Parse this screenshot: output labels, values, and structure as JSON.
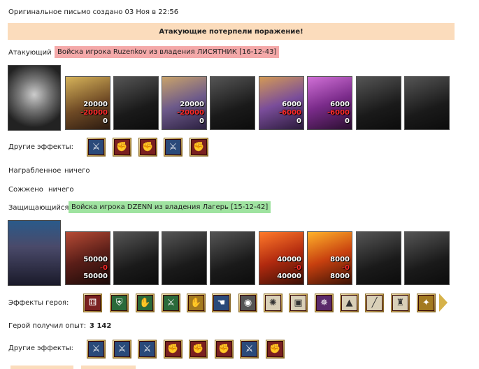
{
  "header": {
    "created": "Оригинальное письмо создано 03 Ноя в 22:56",
    "banner": "Атакующие потерпели поражение!"
  },
  "attacker": {
    "label": "Атакующий",
    "tag": "Войска игрока Ruzenkov из владения ЛИСЯТНИК [16-12-43]",
    "units": [
      {
        "count": "20000",
        "loss": "-20000",
        "left": "0"
      },
      {
        "count": "",
        "loss": "",
        "left": ""
      },
      {
        "count": "20000",
        "loss": "-20000",
        "left": "0"
      },
      {
        "count": "",
        "loss": "",
        "left": ""
      },
      {
        "count": "6000",
        "loss": "-6000",
        "left": "0"
      },
      {
        "count": "6000",
        "loss": "-6000",
        "left": "0"
      },
      {
        "count": "",
        "loss": "",
        "left": ""
      },
      {
        "count": "",
        "loss": "",
        "left": ""
      }
    ],
    "other_effects_label": "Другие эффекты:",
    "other_effects": [
      "sword-icon",
      "fist-icon",
      "fist-icon",
      "sword-icon",
      "fist-icon"
    ],
    "loot_label": "Награбленное",
    "loot_value": "ничего",
    "burned_label": "Сожжено",
    "burned_value": "ничего"
  },
  "defender": {
    "label": "Защищающийся",
    "tag": "Войска игрока DZENN из владения Лагерь [15-12-42]",
    "units": [
      {
        "count": "50000",
        "loss": "-0",
        "left": "50000"
      },
      {
        "count": "",
        "loss": "",
        "left": ""
      },
      {
        "count": "",
        "loss": "",
        "left": ""
      },
      {
        "count": "",
        "loss": "",
        "left": ""
      },
      {
        "count": "40000",
        "loss": "-0",
        "left": "40000"
      },
      {
        "count": "8000",
        "loss": "-0",
        "left": "8000"
      },
      {
        "count": "",
        "loss": "",
        "left": ""
      },
      {
        "count": "",
        "loss": "",
        "left": ""
      }
    ],
    "hero_effects_label": "Эффекты героя:",
    "hero_effects": [
      "dice-icon",
      "shield-icon",
      "handshake-icon",
      "sword-icon",
      "handshake-icon",
      "hand-icon",
      "helmet-icon",
      "web-icon",
      "armor-icon",
      "swirl-icon",
      "fan-icon",
      "blade-icon",
      "crest-icon",
      "scroll-icon"
    ],
    "exp_label": "Герой получил опыт:",
    "exp_value": "3 142",
    "other_effects_label": "Другие эффекты:",
    "other_effects": [
      "sword-icon",
      "sword-icon",
      "sword-icon",
      "fist-icon",
      "fist-icon",
      "fist-icon",
      "sword-icon",
      "fist-icon"
    ]
  },
  "colors": {
    "banner": "#fbdcbc",
    "attacker_tag": "#f4a9a9",
    "defender_tag": "#9fe3a0",
    "loss": "#ff2b2b"
  }
}
